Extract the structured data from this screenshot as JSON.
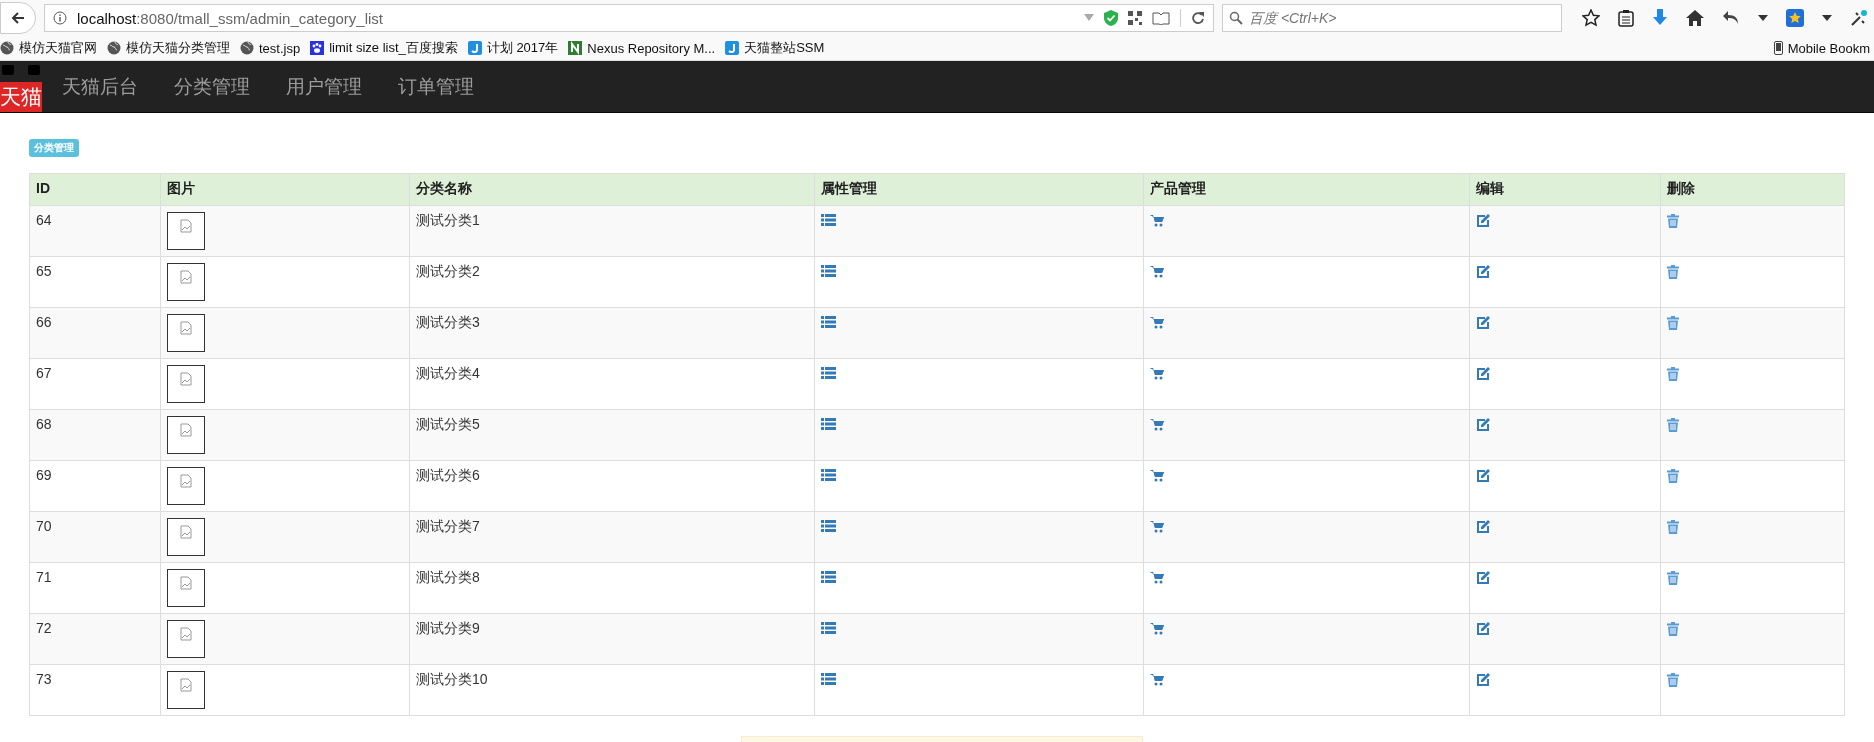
{
  "browser": {
    "url_host": "localhost",
    "url_path": ":8080/tmall_ssm/admin_category_list",
    "search_placeholder": "百度 <Ctrl+K>",
    "bookmarks": [
      {
        "kind": "globe",
        "label": "模仿天猫官网"
      },
      {
        "kind": "globe",
        "label": "模仿天猫分类管理"
      },
      {
        "kind": "globe",
        "label": "test.jsp"
      },
      {
        "kind": "paw",
        "label": "limit size list_百度搜索"
      },
      {
        "kind": "j",
        "label": "计划 2017年"
      },
      {
        "kind": "n",
        "label": "Nexus Repository M..."
      },
      {
        "kind": "j",
        "label": "天猫整站SSM"
      }
    ],
    "mobile_bookmarks": "Mobile Bookm"
  },
  "nav": {
    "logo_text": "天猫",
    "items": [
      "天猫后台",
      "分类管理",
      "用户管理",
      "订单管理"
    ]
  },
  "badge": "分类管理",
  "table": {
    "columns": [
      "ID",
      "图片",
      "分类名称",
      "属性管理",
      "产品管理",
      "编辑",
      "删除"
    ],
    "rows": [
      {
        "id": "64",
        "name": "测试分类1"
      },
      {
        "id": "65",
        "name": "测试分类2"
      },
      {
        "id": "66",
        "name": "测试分类3"
      },
      {
        "id": "67",
        "name": "测试分类4"
      },
      {
        "id": "68",
        "name": "测试分类5"
      },
      {
        "id": "69",
        "name": "测试分类6"
      },
      {
        "id": "70",
        "name": "测试分类7"
      },
      {
        "id": "71",
        "name": "测试分类8"
      },
      {
        "id": "72",
        "name": "测试分类9"
      },
      {
        "id": "73",
        "name": "测试分类10"
      }
    ]
  }
}
